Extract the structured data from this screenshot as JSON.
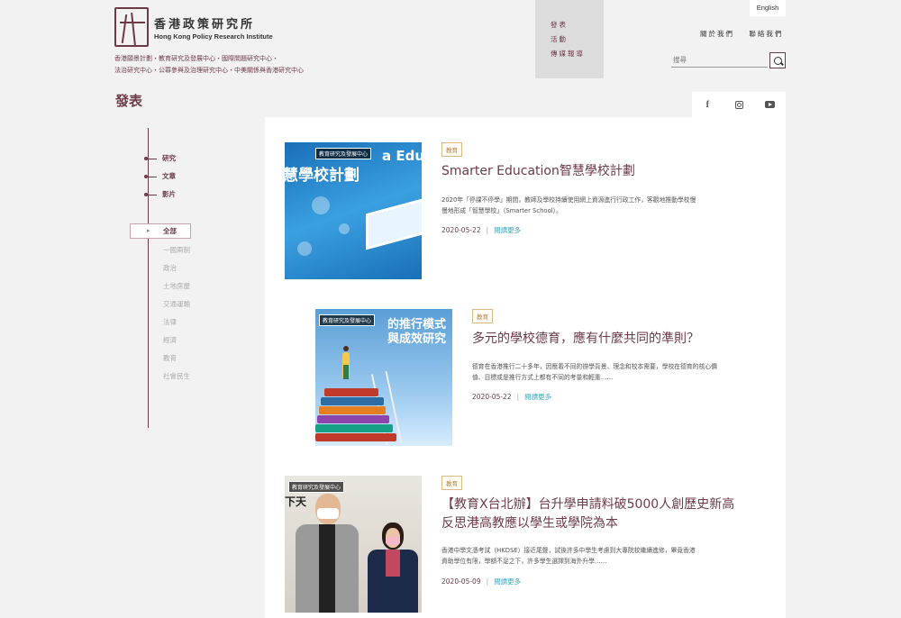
{
  "header": {
    "logo_zh": "香港政策研究所",
    "logo_en": "Hong Kong Policy Research Institute",
    "centres_line1": "香港願景計劃・教育研究及發展中心・國際問題研究中心・",
    "centres_line2": "法治研究中心・公罪參與及治理研究中心・中美關係與香港研究中心",
    "menu": [
      "發表",
      "活動",
      "傳媒報導"
    ],
    "lang_button": "English",
    "about": "關於我們",
    "contact": "聯絡我們",
    "search_placeholder": "搜尋"
  },
  "page_title": "發表",
  "social": [
    "facebook-icon",
    "instagram-icon",
    "youtube-icon"
  ],
  "sidebar": {
    "types": [
      "研究",
      "文章",
      "影片"
    ],
    "categories_selected": "全部",
    "categories": [
      "一國兩制",
      "政治",
      "土地房屋",
      "交通運輸",
      "法律",
      "經濟",
      "教育",
      "社會民生"
    ]
  },
  "posts": [
    {
      "thumb_tag": "教育研究及發展中心",
      "thumb_text": [
        "a Education",
        "慧學校計劃"
      ],
      "tag": "教育",
      "title": "Smarter Education智慧學校計劃",
      "desc_line1": "2020年「停課不停學」期間，教師及學校持續使用網上資源進行行政工作，客觀地推動學校慢",
      "desc_line2": "慢地形成「智慧學校」（Smarter School）。",
      "date": "2020-05-22",
      "more": "閱讀更多"
    },
    {
      "thumb_tag": "教育研究及發展中心",
      "thumb_text": [
        "的推行模式",
        "與成效研究"
      ],
      "tag": "教育",
      "title": "多元的學校德育，應有什麼共同的準則？",
      "desc_line1": "德育在香港推行二十多年，因應着不同的辦學背景、理念和校本需要，學校在德育的核心價",
      "desc_line2": "值、目標或是推行方式上都有不同的考量和輕重……",
      "date": "2020-05-22",
      "more": "閱讀更多"
    },
    {
      "thumb_tag": "教育研究及發展中心",
      "thumb_text": [
        "下天"
      ],
      "tag": "教育",
      "title_line1": "【教育X台北辦】台升學申請料破5000人創歷史新高",
      "title_line2": "反思港高教應以學生或學院為本",
      "desc_line1": "香港中學文憑考試（HKDSE）接近尾聲，試後許多中學生考慮到大專院校繼續進修，畢竟香港",
      "desc_line2": "資助學位有限，學額不足之下，許多學生選擇到海外升學……",
      "date": "2020-05-09",
      "more": "閱讀更多"
    }
  ],
  "colors": {
    "brand": "#6d3a48",
    "link": "#3aa7b9",
    "tag": "#b07c3a"
  }
}
